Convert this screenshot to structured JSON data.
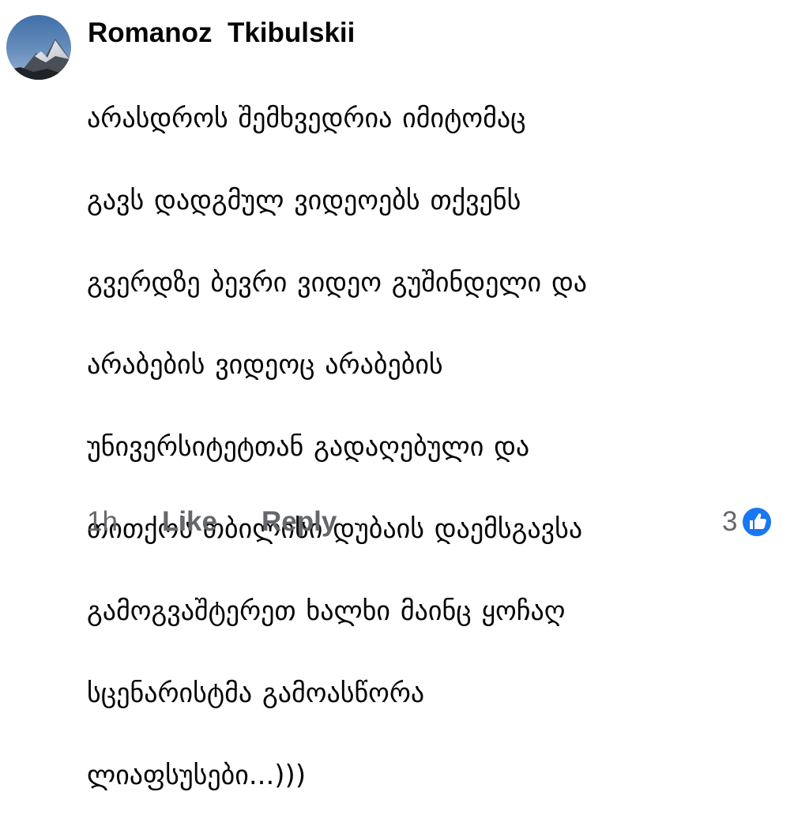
{
  "comment": {
    "author": "Romanoz  Tkibulskii",
    "text_lines": [
      "არასდროს შემხვედრია იმიტომაც",
      "გავს დადგმულ ვიდეოებს თქვენს",
      "გვერდზე ბევრი ვიდეო გუშინდელი და",
      "არაბების ვიდეოც არაბების",
      "უნივერსიტეტთან გადაღებული და",
      "თითქოს თბილისი დუბაის დაემსგავსა",
      "გამოგვაშტერეთ ხალხი მაინც ყოჩაღ",
      "სცენარისტმა გამოასწორა",
      "ლიაფსუსები...)))"
    ],
    "timestamp": "1h",
    "like_label": "Like",
    "reply_label": "Reply",
    "reaction_count": "3",
    "reaction_icon": "like-icon",
    "avatar_icon": "mountain-avatar"
  },
  "colors": {
    "text": "#050505",
    "secondary": "#65676b",
    "like_blue": "#1877f2"
  }
}
